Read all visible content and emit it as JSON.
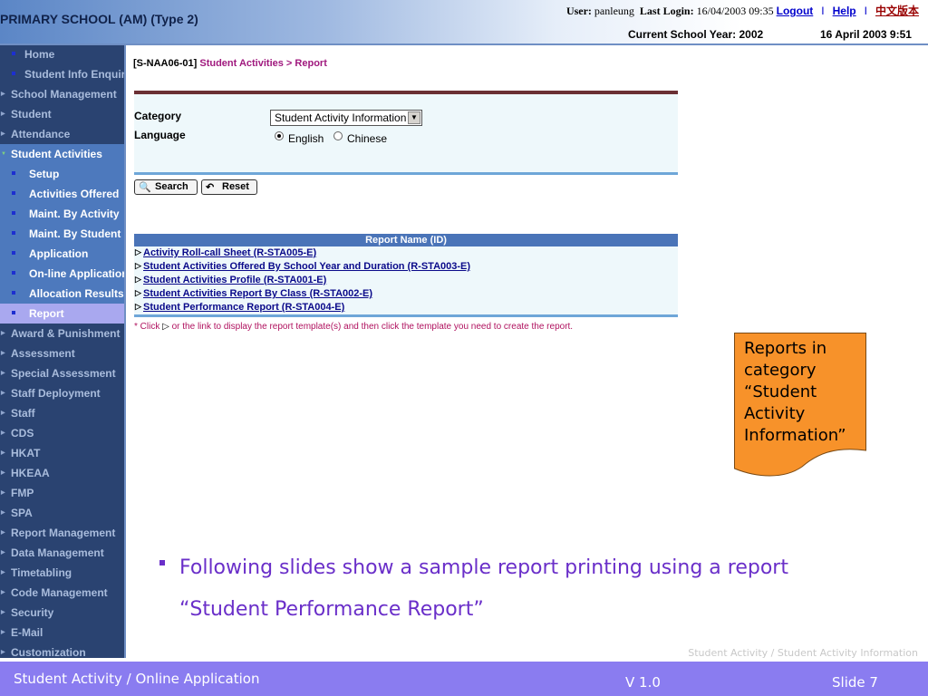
{
  "header": {
    "title": "PRIMARY SCHOOL (AM) (Type 2)",
    "user_label": "User:",
    "user_name": "panleung",
    "last_login_label": "Last Login:",
    "last_login": "16/04/2003 09:35",
    "logout": "Logout",
    "separator": "I",
    "help": "Help",
    "chinese": "中文版本",
    "school_year": "Current School Year: 2002",
    "date_time": "16 April 2003 9:51"
  },
  "sidebar": {
    "items": [
      {
        "label": "Home",
        "level": "sub"
      },
      {
        "label": "Student Info Enquiry",
        "level": "sub"
      },
      {
        "label": "School Management",
        "level": "top"
      },
      {
        "label": "Student",
        "level": "top"
      },
      {
        "label": "Attendance",
        "level": "top"
      },
      {
        "label": "Student Activities",
        "level": "top"
      },
      {
        "label": "Setup",
        "level": "sub"
      },
      {
        "label": "Activities Offered",
        "level": "sub"
      },
      {
        "label": "Maint. By Activity",
        "level": "sub"
      },
      {
        "label": "Maint. By Student",
        "level": "sub"
      },
      {
        "label": "Application",
        "level": "sub"
      },
      {
        "label": "On-line Application",
        "level": "sub"
      },
      {
        "label": "Allocation Results",
        "level": "sub"
      },
      {
        "label": "Report",
        "level": "sub"
      },
      {
        "label": "Award & Punishment",
        "level": "top"
      },
      {
        "label": "Assessment",
        "level": "top"
      },
      {
        "label": "Special Assessment",
        "level": "top"
      },
      {
        "label": "Staff Deployment",
        "level": "top"
      },
      {
        "label": "Staff",
        "level": "top"
      },
      {
        "label": "CDS",
        "level": "top"
      },
      {
        "label": "HKAT",
        "level": "top"
      },
      {
        "label": "HKEAA",
        "level": "top"
      },
      {
        "label": "FMP",
        "level": "top"
      },
      {
        "label": "SPA",
        "level": "top"
      },
      {
        "label": "Report Management",
        "level": "top"
      },
      {
        "label": "Data Management",
        "level": "top"
      },
      {
        "label": "Timetabling",
        "level": "top"
      },
      {
        "label": "Code Management",
        "level": "top"
      },
      {
        "label": "Security",
        "level": "top"
      },
      {
        "label": "E-Mail",
        "level": "top"
      },
      {
        "label": "Customization",
        "level": "top"
      }
    ]
  },
  "breadcrumb": {
    "code": "[S-NAA06-01]",
    "section": "Student Activities",
    "sep": ">",
    "page": "Report"
  },
  "form": {
    "category_label": "Category",
    "category_value": "Student Activity Information",
    "language_label": "Language",
    "lang_english": "English",
    "lang_chinese": "Chinese",
    "search_label": "Search",
    "reset_label": "Reset"
  },
  "table": {
    "header": "Report Name (ID)",
    "reports": [
      "Activity Roll-call Sheet (R-STA005-E)",
      "Student Activities Offered By School Year and Duration (R-STA003-E)",
      "Student Activities Profile (R-STA001-E)",
      "Student Activities Report By Class (R-STA002-E)",
      "Student Performance Report (R-STA004-E)"
    ],
    "footnote_a": "* Click",
    "footnote_b": "or the link to display the report template(s) and then click the template you need to create the report."
  },
  "callout": {
    "line1": "Reports in",
    "line2": "category",
    "line3": "“Student",
    "line4": "Activity",
    "line5": "Information”"
  },
  "slide": {
    "bullet_line1": "Following slides show a sample report printing using a report",
    "bullet_line2": "“Student Performance Report”",
    "footer_path": "Student Activity / Student Activity Information",
    "bottom_left": "Student Activity / Online Application",
    "version": "V 1.0",
    "slide_no": "Slide 7"
  },
  "colors": {
    "sidebar_bg": "#2a4371",
    "accent_purple": "#6a2fc9",
    "bottom_bar": "#8a7cf0",
    "callout_orange": "#f7922a"
  }
}
